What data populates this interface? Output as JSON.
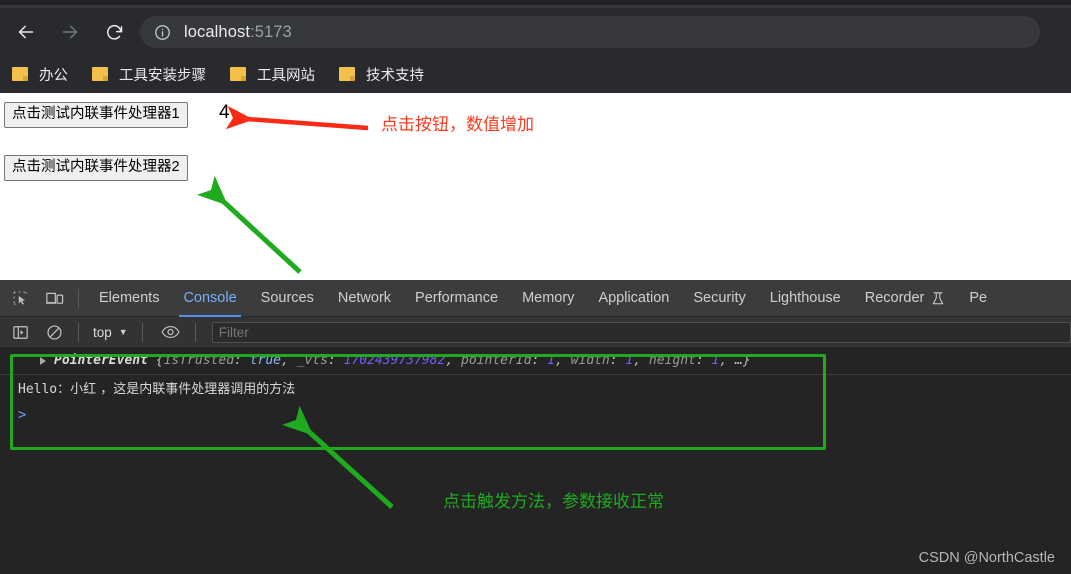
{
  "browser": {
    "back_icon": "arrow-left-icon",
    "forward_icon": "arrow-right-icon",
    "reload_icon": "reload-icon",
    "site_info_icon": "info-circle-icon",
    "url_host": "localhost",
    "url_port": ":5173",
    "bookmarks": [
      {
        "label": "办公",
        "icon": "folder-icon"
      },
      {
        "label": "工具安装步骤",
        "icon": "folder-icon"
      },
      {
        "label": "工具网站",
        "icon": "folder-icon"
      },
      {
        "label": "技术支持",
        "icon": "folder-icon"
      }
    ]
  },
  "page": {
    "button1_label": "点击测试内联事件处理器1",
    "button2_label": "点击测试内联事件处理器2",
    "counter_value": "4"
  },
  "annotations": {
    "red_note": "点击按钮，数值增加",
    "green_note": "点击触发方法，参数接收正常",
    "red_color": "#fb3b1e",
    "green_color": "#1faa1f"
  },
  "devtools": {
    "inspect_icon": "inspect-element-icon",
    "device_icon": "device-toolbar-icon",
    "tabs": [
      {
        "label": "Elements",
        "active": false
      },
      {
        "label": "Console",
        "active": true
      },
      {
        "label": "Sources",
        "active": false
      },
      {
        "label": "Network",
        "active": false
      },
      {
        "label": "Performance",
        "active": false
      },
      {
        "label": "Memory",
        "active": false
      },
      {
        "label": "Application",
        "active": false
      },
      {
        "label": "Security",
        "active": false
      },
      {
        "label": "Lighthouse",
        "active": false
      },
      {
        "label": "Recorder",
        "active": false,
        "icon": "flask-icon"
      },
      {
        "label": "Pe",
        "active": false
      }
    ],
    "active_tab_color": "#7aaefc",
    "toolbar": {
      "sidebar_icon": "console-sidebar-icon",
      "clear_icon": "clear-console-icon",
      "context_value": "top",
      "caret_icon": "chevron-down-icon",
      "eye_icon": "eye-icon",
      "filter_placeholder": "Filter",
      "filter_value": ""
    },
    "console": {
      "message1": {
        "expand_icon": "expand-triangle-icon",
        "class_name": "PointerEvent",
        "open_brace": " {",
        "prop1_key": "isTrusted",
        "prop1_val": "true",
        "prop2_key": "_vts",
        "prop2_val": "1702439737982",
        "prop3_key": "pointerId",
        "prop3_val": "1",
        "prop4_key": "width",
        "prop4_val": "1",
        "prop5_key": "height",
        "prop5_val": "1",
        "ellipsis": ", …}"
      },
      "message2_prefix": "Hello",
      "message2_rest": "：小红 ，这是内联事件处理器调用的方法",
      "prompt_caret": ">"
    }
  },
  "watermark": "CSDN @NorthCastle"
}
